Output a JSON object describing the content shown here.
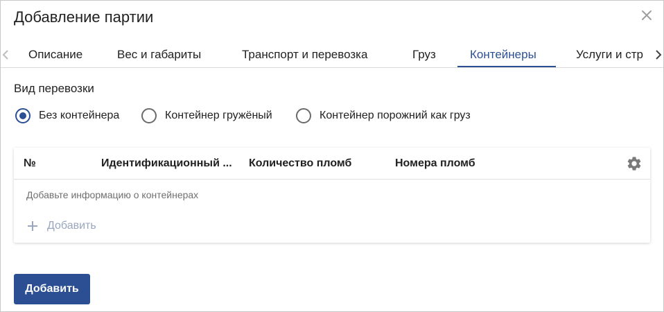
{
  "dialog": {
    "title": "Добавление партии"
  },
  "tabs": [
    {
      "label": "Описание",
      "active": false
    },
    {
      "label": "Вес и габариты",
      "active": false
    },
    {
      "label": "Транспорт и перевозка",
      "active": false
    },
    {
      "label": "Груз",
      "active": false
    },
    {
      "label": "Контейнеры",
      "active": true
    },
    {
      "label": "Услуги и стр",
      "active": false
    }
  ],
  "transport_type": {
    "label": "Вид перевозки",
    "options": [
      {
        "label": "Без контейнера",
        "checked": true
      },
      {
        "label": "Контейнер гружёный",
        "checked": false
      },
      {
        "label": "Контейнер порожний как груз",
        "checked": false
      }
    ]
  },
  "table": {
    "columns": [
      "№",
      "Идентификационный ...",
      "Количество пломб",
      "Номера пломб"
    ],
    "empty_text": "Добавьте информацию о контейнерах",
    "add_label": "Добавить"
  },
  "footer": {
    "add_button": "Добавить"
  },
  "colors": {
    "accent": "#2c4f94",
    "add_link": "#9aa6bd"
  }
}
